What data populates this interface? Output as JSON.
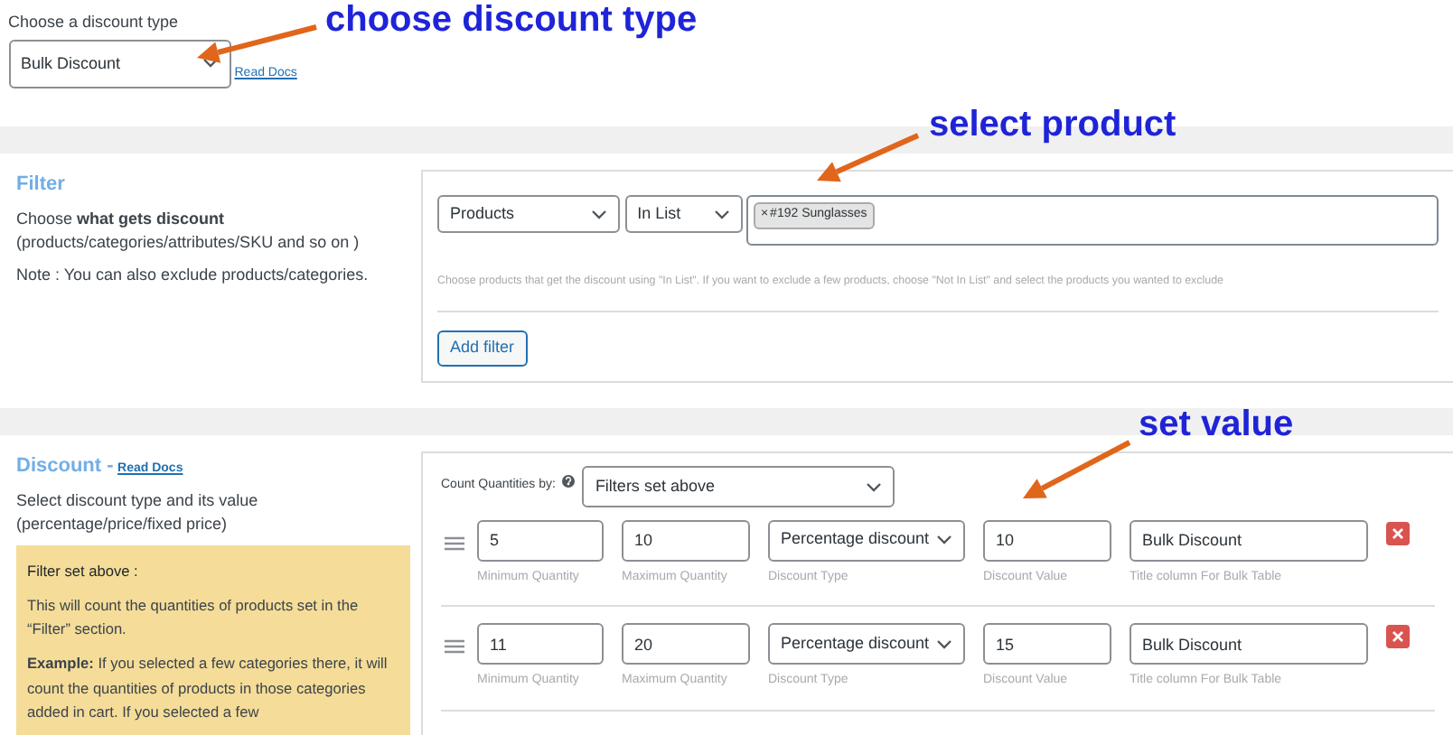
{
  "discount_type": {
    "label": "Choose a discount type",
    "value": "Bulk Discount",
    "link": "Read Docs"
  },
  "filter": {
    "title": "Filter",
    "description": [
      "Choose **what gets discount**",
      "(products/categories/attributes/SKU and so on )"
    ],
    "note": "Note : You can also exclude products/categories.",
    "rule": {
      "type": "Products",
      "operator": "In List",
      "tags": [
        {
          "remove": "×",
          "label": "#192 Sunglasses"
        }
      ],
      "hint": "Choose products that get the discount using \"In List\". If you want to exclude a few products, choose \"Not In List\" and select the products you wanted to exclude"
    },
    "add_button": "Add filter"
  },
  "discount": {
    "title": "Discount -",
    "link": "Read Docs",
    "description": [
      "Select discount type and its value",
      "(percentage/price/fixed price)"
    ],
    "info": {
      "title": "Filter set above :",
      "paragraphs": [
        "This will count the quantities of products set in the “Filter” section.",
        "**Example:** If you selected a few categories there, it will count the quantities of products in those categories added in cart. If you selected a few"
      ]
    },
    "count_label": "Count Quantities by:",
    "count_value": "Filters set above",
    "ranges": [
      {
        "fields": [
          {
            "kind": "input",
            "value": "5",
            "caption": "Minimum Quantity"
          },
          {
            "kind": "input",
            "value": "10",
            "caption": "Maximum Quantity"
          },
          {
            "kind": "select",
            "value": "Percentage discount",
            "caption": "Discount Type"
          },
          {
            "kind": "input",
            "value": "10",
            "caption": "Discount Value"
          },
          {
            "kind": "input",
            "value": "Bulk Discount",
            "caption": "Title column For Bulk Table"
          }
        ]
      },
      {
        "fields": [
          {
            "kind": "input",
            "value": "11",
            "caption": "Minimum Quantity"
          },
          {
            "kind": "input",
            "value": "20",
            "caption": "Maximum Quantity"
          },
          {
            "kind": "select",
            "value": "Percentage discount",
            "caption": "Discount Type"
          },
          {
            "kind": "input",
            "value": "15",
            "caption": "Discount Value"
          },
          {
            "kind": "input",
            "value": "Bulk Discount",
            "caption": "Title column For Bulk Table"
          }
        ]
      }
    ]
  },
  "annotations": [
    {
      "text": "choose discount type"
    },
    {
      "text": "select product"
    },
    {
      "text": "set value"
    }
  ]
}
